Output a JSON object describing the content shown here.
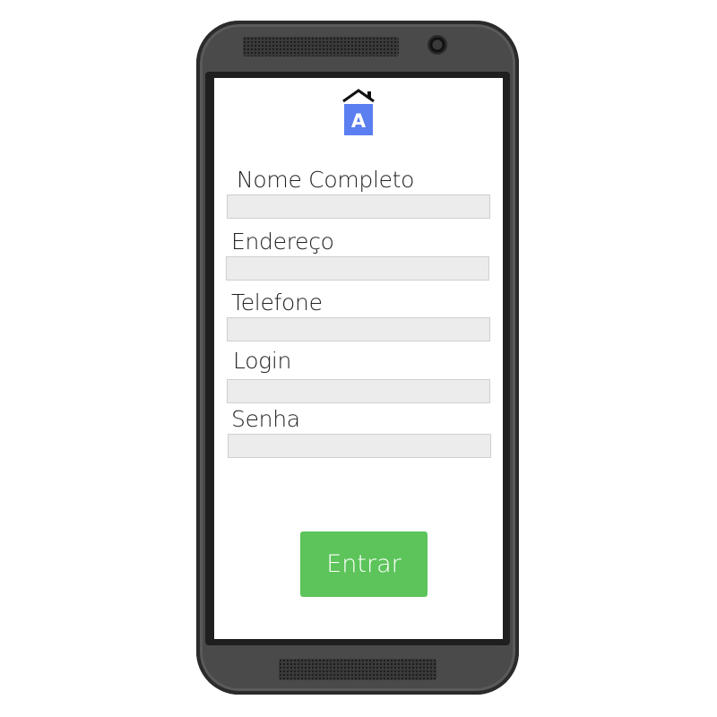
{
  "app": {
    "logo_letter": "A",
    "logo_icon": "house-a-icon",
    "accent_color": "#5b7ff0"
  },
  "form": {
    "fields": [
      {
        "label": "Nome Completo",
        "value": "",
        "placeholder": ""
      },
      {
        "label": "Endereço",
        "value": "",
        "placeholder": ""
      },
      {
        "label": "Telefone",
        "value": "",
        "placeholder": ""
      },
      {
        "label": "Login",
        "value": "",
        "placeholder": ""
      },
      {
        "label": "Senha",
        "value": "",
        "placeholder": ""
      }
    ],
    "submit_label": "Entrar",
    "submit_color": "#5cc45a"
  }
}
